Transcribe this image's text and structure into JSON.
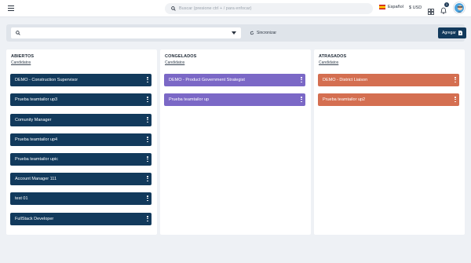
{
  "topbar": {
    "search_placeholder": "Buscar (presione ctrl + / para enfocar)",
    "language": "Español",
    "currency": "$ USD",
    "notification_count": "1"
  },
  "filterbar": {
    "sync_label": "Sincronizar",
    "add_label": "Agregar"
  },
  "columns": [
    {
      "title": "ABIERTOS",
      "subtitle": "Candidatos",
      "color": "#123a5c",
      "cards": [
        "DEMO - Construction Supervisor",
        "Prueba teamtailor up3",
        "Comunity Manager",
        "Prueba teamtailor up4",
        "Prueba teamtailor upic",
        "Account Manager 111",
        "test 01",
        "FullStack Developer"
      ]
    },
    {
      "title": "CONGELADOS",
      "subtitle": "Candidatos",
      "color": "#7b68c6",
      "cards": [
        "DEMO - Product Government Strategist",
        "Prueba teamtailor up"
      ]
    },
    {
      "title": "ATRASADOS",
      "subtitle": "Candidatos",
      "color": "#d46f51",
      "cards": [
        "DEMO - District Liaison",
        "Prueba teamtailor up2"
      ]
    }
  ]
}
